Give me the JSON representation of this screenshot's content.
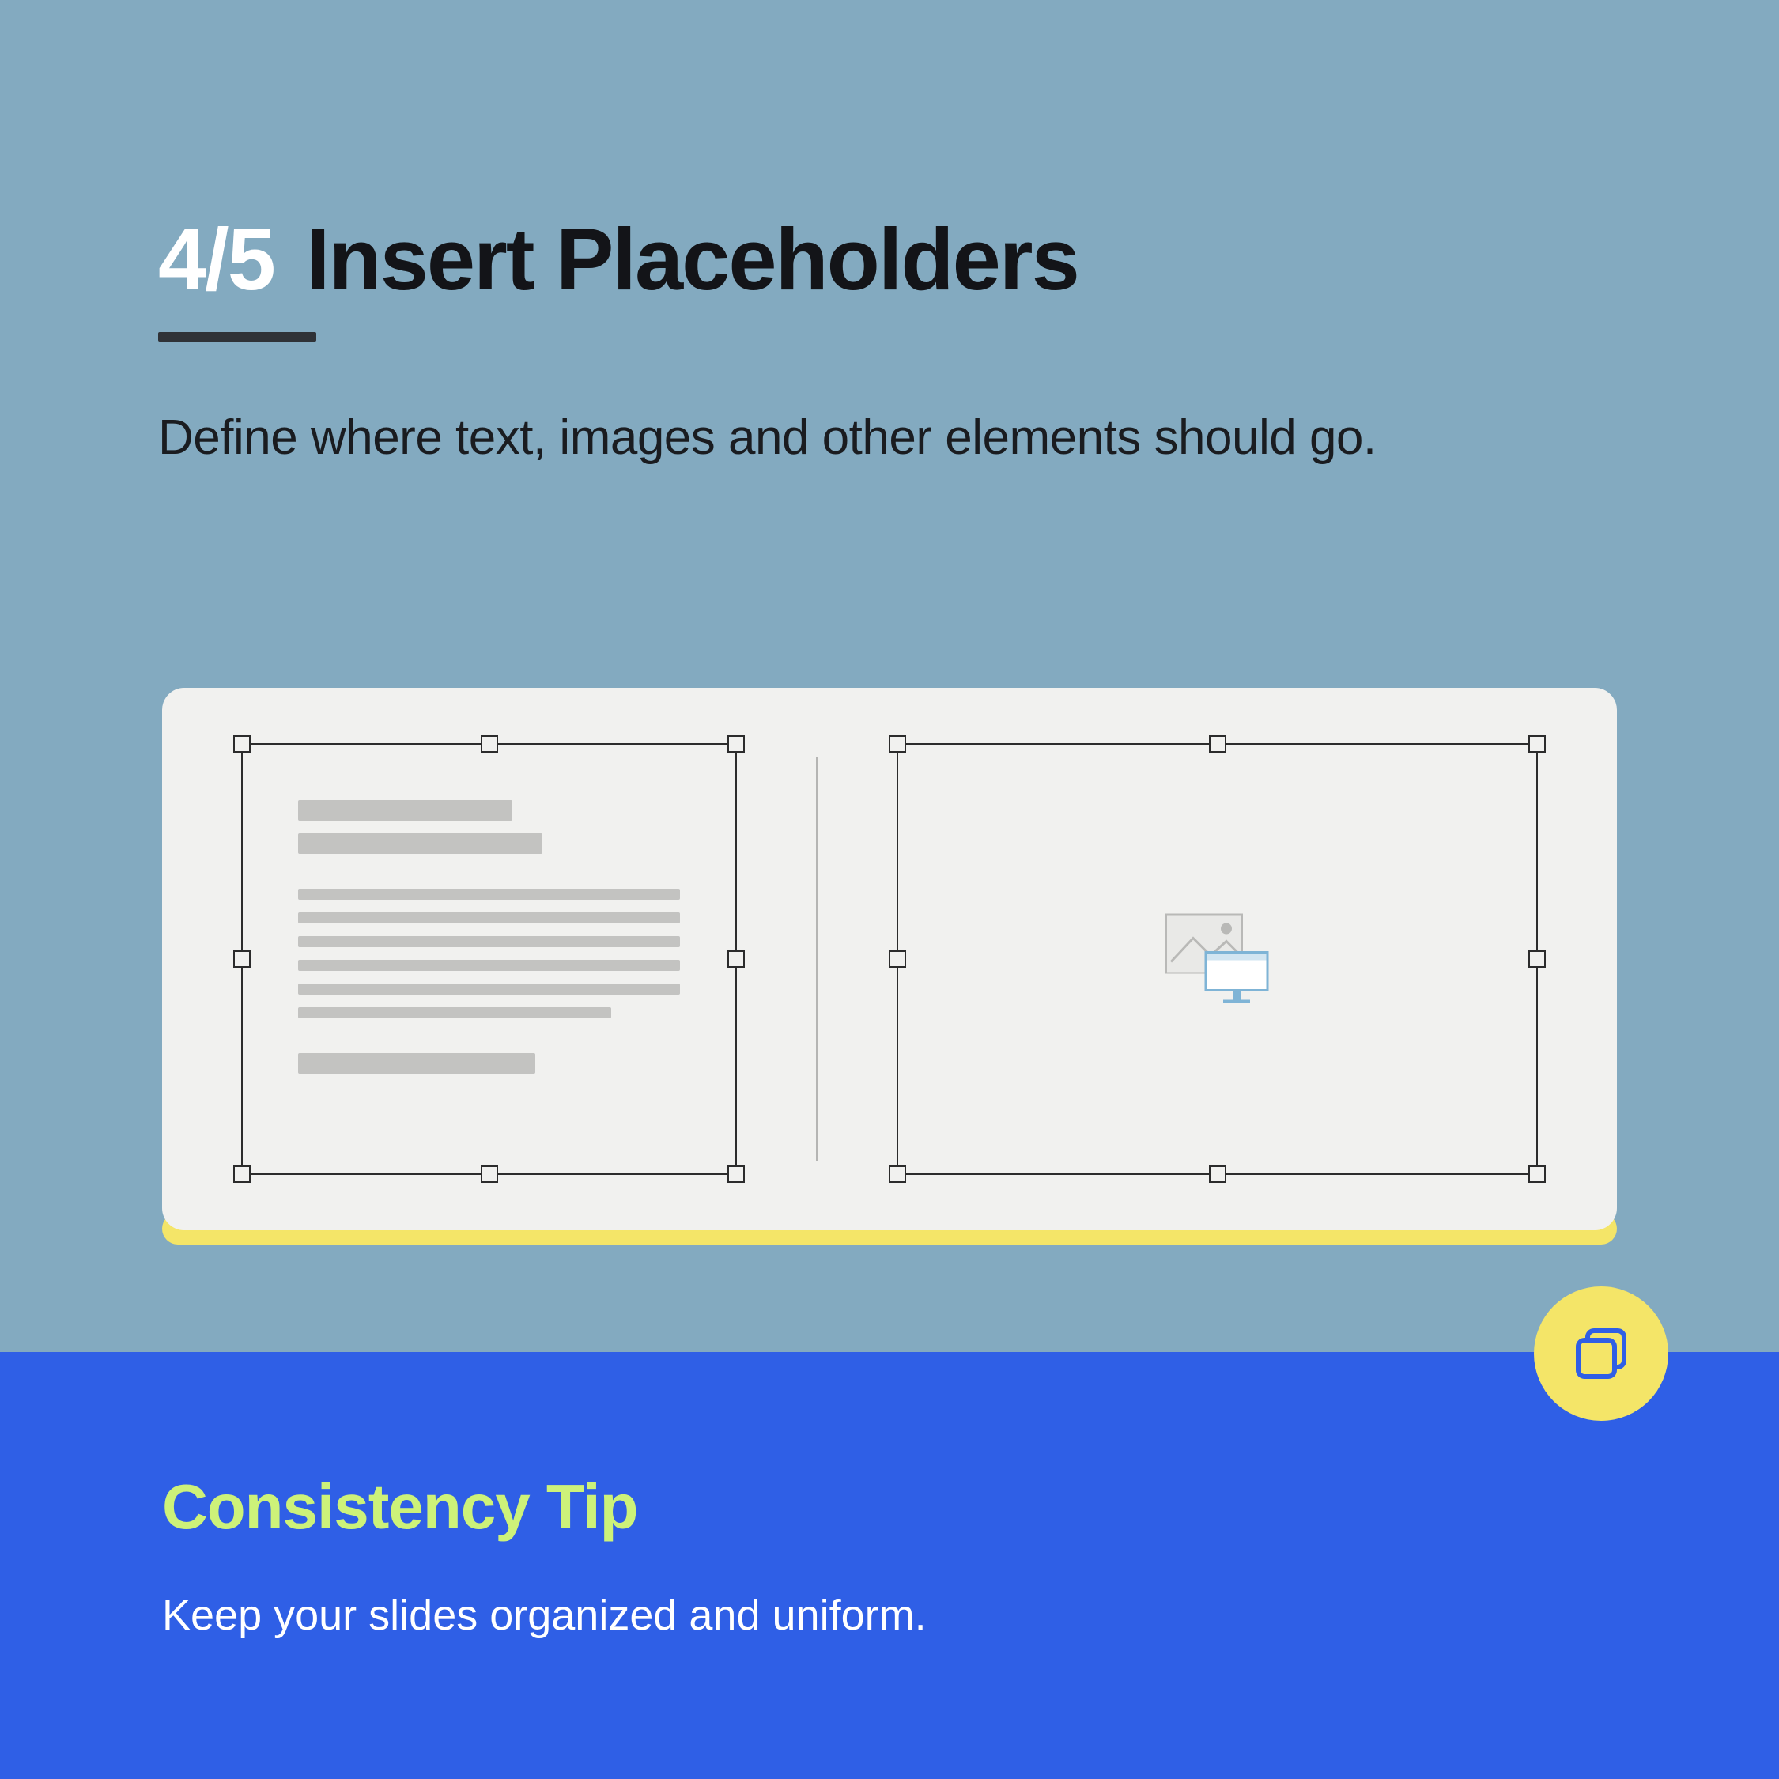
{
  "header": {
    "step_counter": "4/5",
    "title": "Insert Placeholders",
    "subtitle": "Define where text, images and other elements should go."
  },
  "tip": {
    "heading": "Consistency Tip",
    "body": "Keep your slides organized and uniform."
  },
  "icons": {
    "badge": "layers-icon",
    "text_placeholder": "text-placeholder-icon",
    "image_placeholder": "image-placeholder-icon"
  },
  "colors": {
    "page_bg": "#83aac0",
    "footer_bg": "#2f5fe6",
    "accent_yellow": "#f4e568",
    "tip_heading": "#cdf279"
  }
}
